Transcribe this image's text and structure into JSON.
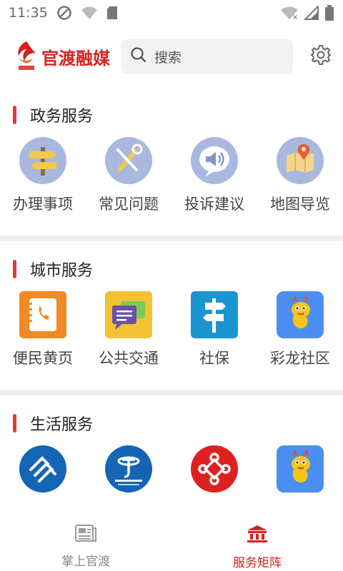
{
  "status": {
    "time": "11:35",
    "sim_badge": "?"
  },
  "header": {
    "logo_text": "官渡融媒",
    "search_placeholder": "搜索"
  },
  "sections": [
    {
      "title": "政务服务",
      "items": [
        {
          "label": "办理事项",
          "icon": "signpost-icon"
        },
        {
          "label": "常见问题",
          "icon": "tools-icon"
        },
        {
          "label": "投诉建议",
          "icon": "speaker-bubble-icon"
        },
        {
          "label": "地图导览",
          "icon": "map-pin-icon"
        }
      ]
    },
    {
      "title": "城市服务",
      "items": [
        {
          "label": "便民黄页",
          "icon": "phonebook-icon"
        },
        {
          "label": "公共交通",
          "icon": "chat-bubbles-icon"
        },
        {
          "label": "社保",
          "icon": "direction-sign-icon"
        },
        {
          "label": "彩龙社区",
          "icon": "dragon-icon"
        }
      ]
    },
    {
      "title": "生活服务",
      "items": [
        {
          "label": "",
          "icon": "china-mobile-icon"
        },
        {
          "label": "",
          "icon": "china-telecom-icon"
        },
        {
          "label": "",
          "icon": "china-unicom-icon"
        },
        {
          "label": "",
          "icon": "dragon-icon"
        }
      ]
    }
  ],
  "bottom_nav": [
    {
      "label": "掌上官渡",
      "active": false
    },
    {
      "label": "服务矩阵",
      "active": true
    }
  ],
  "colors": {
    "accent": "#d7221f",
    "title_bar": "#e53935",
    "inactive_nav": "#888888"
  }
}
